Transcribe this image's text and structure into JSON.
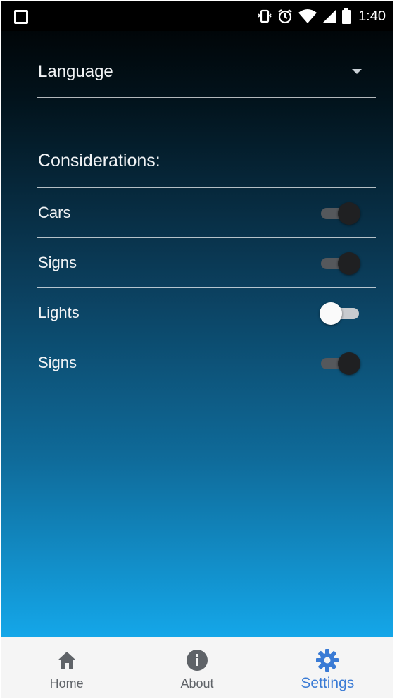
{
  "status_bar": {
    "time": "1:40"
  },
  "settings": {
    "language_label": "Language",
    "considerations_title": "Considerations:",
    "items": [
      {
        "label": "Cars",
        "enabled": true
      },
      {
        "label": "Signs",
        "enabled": true
      },
      {
        "label": "Lights",
        "enabled": false
      },
      {
        "label": "Signs",
        "enabled": true
      }
    ]
  },
  "nav": {
    "items": [
      {
        "label": "Home",
        "icon": "home-icon",
        "active": false
      },
      {
        "label": "About",
        "icon": "info-icon",
        "active": false
      },
      {
        "label": "Settings",
        "icon": "gear-icon",
        "active": true
      }
    ]
  },
  "colors": {
    "accent": "#3a7bd5",
    "nav_inactive": "#5f6368",
    "toggle_on_knob": "#1f2022",
    "toggle_off_knob": "#fafafa"
  }
}
